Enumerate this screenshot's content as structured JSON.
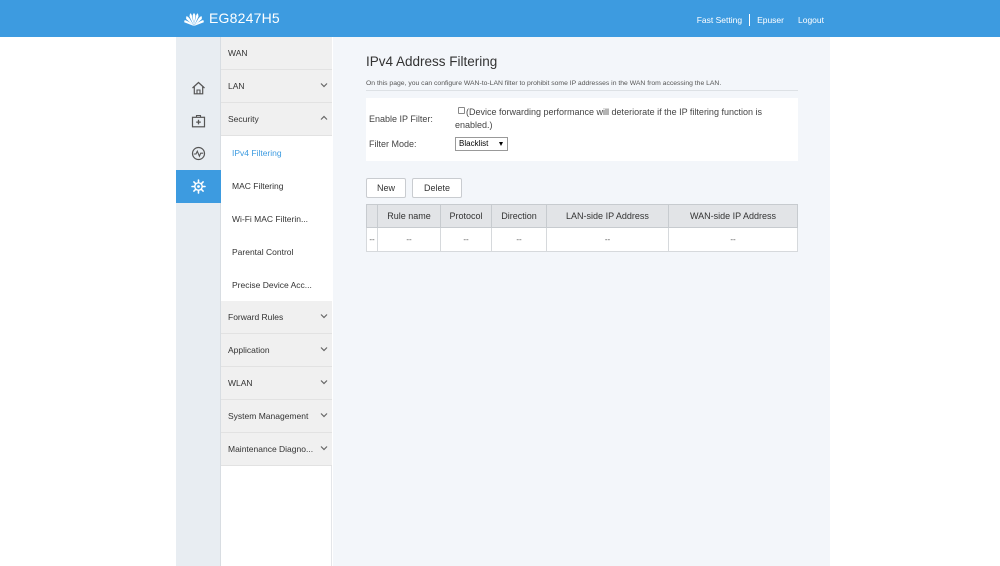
{
  "header": {
    "product_name": "EG8247H5",
    "nav": {
      "fast_setting": "Fast Setting",
      "user": "Epuser",
      "logout": "Logout"
    },
    "brand_color": "#3d9be0"
  },
  "icon_rail": [
    {
      "name": "home-icon",
      "active": false
    },
    {
      "name": "medical-kit-icon",
      "active": false
    },
    {
      "name": "diagnostics-icon",
      "active": false
    },
    {
      "name": "gear-icon",
      "active": true
    }
  ],
  "sidebar": {
    "wan": "WAN",
    "lan": "LAN",
    "security": "Security",
    "security_items": {
      "ipv4_filtering": "IPv4 Filtering",
      "mac_filtering": "MAC Filtering",
      "wifi_mac_filtering": "Wi-Fi MAC Filterin...",
      "parental_control": "Parental Control",
      "precise_device": "Precise Device Acc..."
    },
    "forward_rules": "Forward Rules",
    "application": "Application",
    "wlan": "WLAN",
    "system_management": "System Management",
    "maintenance": "Maintenance Diagno..."
  },
  "main": {
    "title": "IPv4 Address Filtering",
    "description": "On this page, you can configure WAN-to-LAN filter to prohibit some IP addresses in the WAN from accessing the LAN.",
    "enable_label": "Enable IP Filter:",
    "enable_checked": false,
    "enable_note": "(Device forwarding performance will deteriorate if the IP filtering function is enabled.)",
    "mode_label": "Filter Mode:",
    "mode_value": "Blacklist",
    "new_button": "New",
    "delete_button": "Delete",
    "table": {
      "headers": [
        "",
        "Rule name",
        "Protocol",
        "Direction",
        "LAN-side IP Address",
        "WAN-side IP Address"
      ],
      "row": [
        "--",
        "--",
        "--",
        "--",
        "--",
        "--"
      ]
    }
  }
}
